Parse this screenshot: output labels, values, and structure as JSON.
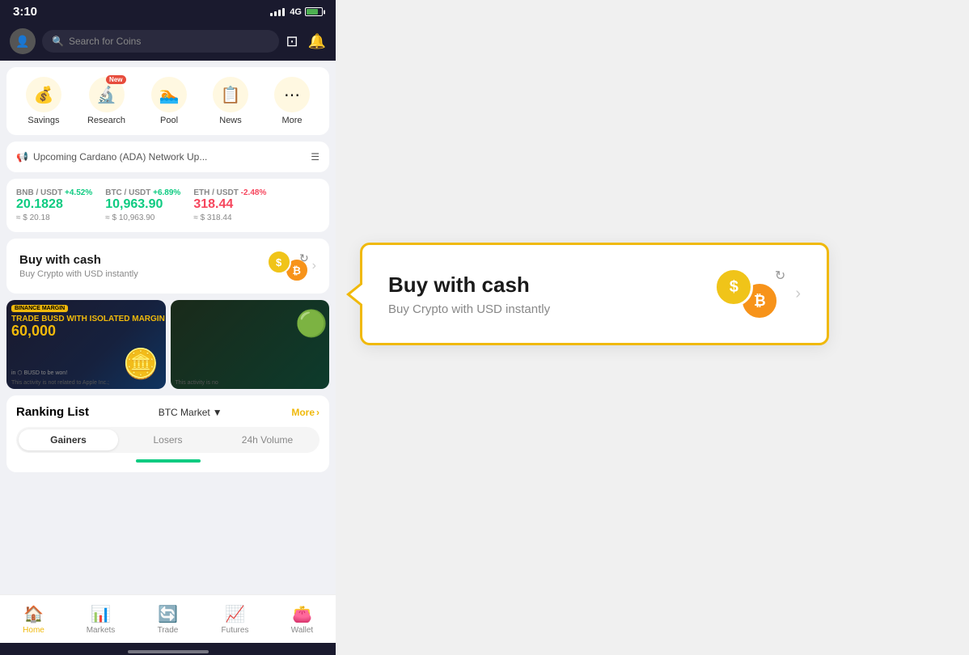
{
  "status": {
    "time": "3:10",
    "signal": "4G",
    "battery": "80"
  },
  "search": {
    "placeholder": "Search for Coins"
  },
  "quickAccess": {
    "items": [
      {
        "id": "savings",
        "icon": "💰",
        "label": "Savings",
        "badge": false
      },
      {
        "id": "research",
        "icon": "🔬",
        "label": "Research",
        "badge": true
      },
      {
        "id": "pool",
        "icon": "🏊",
        "label": "Pool",
        "badge": false
      },
      {
        "id": "news",
        "icon": "📋",
        "label": "News",
        "badge": false
      },
      {
        "id": "more",
        "icon": "⋯",
        "label": "More",
        "badge": false
      }
    ]
  },
  "announcement": {
    "text": "Upcoming Cardano (ADA) Network Up..."
  },
  "ticker": {
    "items": [
      {
        "pair": "BNB / USDT",
        "change": "+4.52%",
        "positive": true,
        "price": "20.1828",
        "usd": "≈ $ 20.18"
      },
      {
        "pair": "BTC / USDT",
        "change": "+6.89%",
        "positive": true,
        "price": "10,963.90",
        "usd": "≈ $ 10,963.90"
      },
      {
        "pair": "ETH / USDT",
        "change": "-2.48%",
        "positive": false,
        "price": "318.44",
        "usd": "≈ $ 318.44"
      }
    ]
  },
  "buyCash": {
    "title": "Buy with cash",
    "subtitle": "Buy Crypto with USD instantly"
  },
  "banners": [
    {
      "type": "binance",
      "brand": "BINANCE MARGIN",
      "tagline": "TRADE BUSD WITH ISOLATED MARGIN",
      "amount": "60,000",
      "unit": "in BUSD to be won!",
      "disclaimer": "This activity is not related to Apple Inc.;"
    },
    {
      "type": "tether",
      "disclaimer": "This activity is no"
    }
  ],
  "ranking": {
    "title": "Ranking List",
    "market": "BTC Market",
    "more": "More",
    "tabs": [
      "Gainers",
      "Losers",
      "24h Volume"
    ],
    "activeTab": 0
  },
  "bottomNav": {
    "items": [
      {
        "id": "home",
        "icon": "🏠",
        "label": "Home",
        "active": true
      },
      {
        "id": "markets",
        "icon": "📊",
        "label": "Markets",
        "active": false
      },
      {
        "id": "trade",
        "icon": "🔄",
        "label": "Trade",
        "active": false
      },
      {
        "id": "futures",
        "icon": "📈",
        "label": "Futures",
        "active": false
      },
      {
        "id": "wallet",
        "icon": "👛",
        "label": "Wallet",
        "active": false
      }
    ]
  },
  "callout": {
    "title": "Buy with cash",
    "subtitle": "Buy Crypto with USD instantly"
  }
}
